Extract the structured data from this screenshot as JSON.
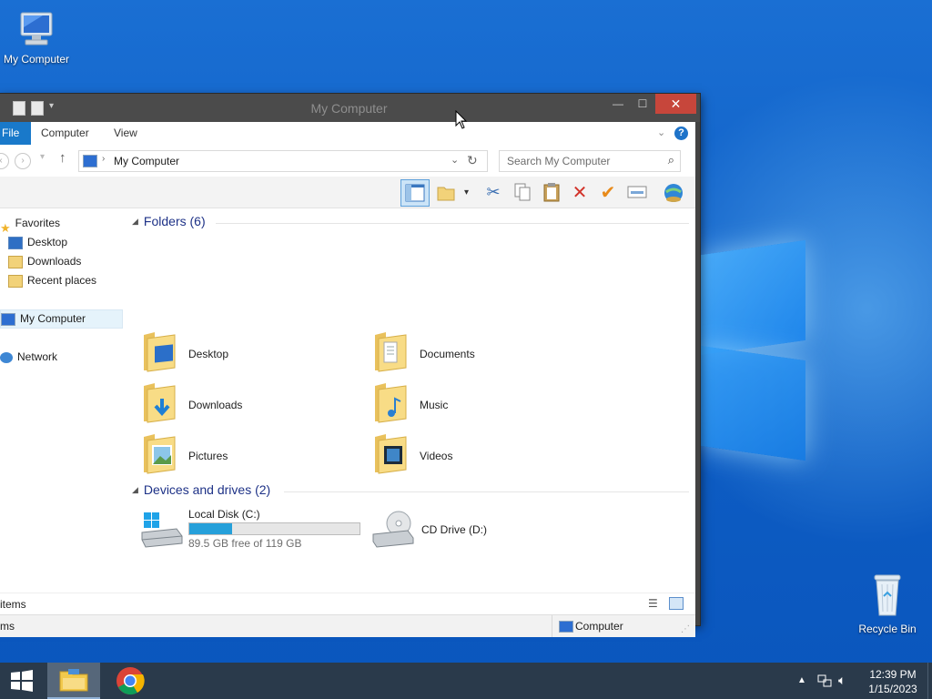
{
  "desktop": {
    "icons": [
      {
        "label": "My Computer"
      },
      {
        "label": "Recycle Bin"
      }
    ]
  },
  "window": {
    "title": "My Computer",
    "tabs": [
      "File",
      "Computer",
      "View"
    ],
    "address": "My Computer",
    "search_placeholder": "Search My Computer",
    "nav": {
      "favorites": "Favorites",
      "desktop": "Desktop",
      "downloads": "Downloads",
      "recent": "Recent places",
      "computer": "My Computer",
      "network": "Network"
    },
    "folders_header": "Folders (6)",
    "folders": [
      "Desktop",
      "Documents",
      "Downloads",
      "Music",
      "Pictures",
      "Videos"
    ],
    "drives_header": "Devices and drives (2)",
    "drives": [
      {
        "name": "Local Disk (C:)",
        "free": "89.5 GB free of 119 GB",
        "used_fraction": 0.25
      },
      {
        "name": "CD Drive (D:)"
      }
    ],
    "status_left": "items",
    "details_left": "ms",
    "details_right": "Computer"
  },
  "taskbar": {
    "time": "12:39 PM",
    "date": "1/15/2023"
  },
  "colors": {
    "accent": "#1979ca",
    "close": "#c7463b",
    "header_text": "#1e3287",
    "drive_bar": "#26a0da"
  }
}
